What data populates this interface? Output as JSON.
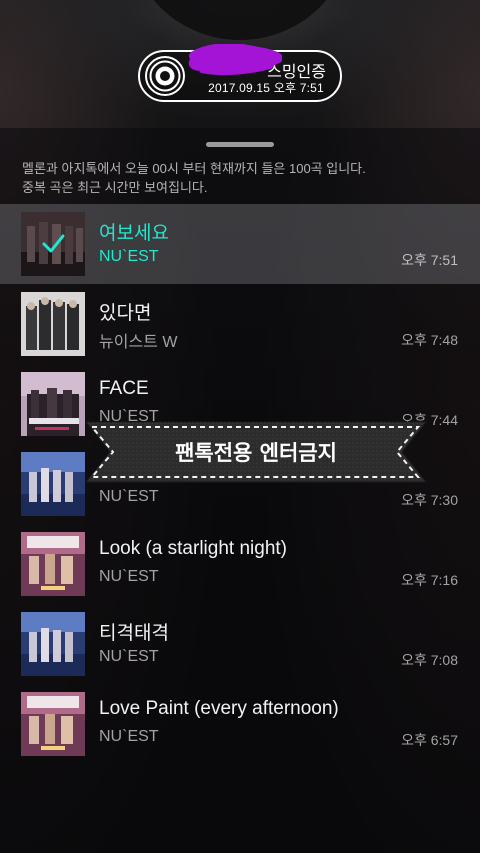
{
  "cert": {
    "title": "스밍인증",
    "date": "2017.09.15 오후 7:51"
  },
  "info": {
    "line1": "멜론과 아지톡에서 오늘 00시 부터 현재까지 들은 100곡 입니다.",
    "line2": "중복 곡은 최근 시간만 보여집니다."
  },
  "songs": [
    {
      "title": "여보세요",
      "artist": "NU`EST",
      "time": "오후 7:51",
      "selected": true
    },
    {
      "title": "있다면",
      "artist": "뉴이스트 W",
      "time": "오후 7:48"
    },
    {
      "title": "FACE",
      "artist": "NU`EST",
      "time": "오후 7:44"
    },
    {
      "title": "",
      "artist": "NU`EST",
      "time": "오후 7:30"
    },
    {
      "title": "Look (a starlight night)",
      "artist": "NU`EST",
      "time": "오후 7:16"
    },
    {
      "title": "티격태격",
      "artist": "NU`EST",
      "time": "오후 7:08"
    },
    {
      "title": "Love Paint (every afternoon)",
      "artist": "NU`EST",
      "time": "오후 6:57"
    }
  ],
  "banner": {
    "text": "팬톡전용 엔터금지"
  },
  "colors": {
    "accent": "#1ee8d2",
    "scribble": "#a314d6"
  },
  "icons": {
    "cert": "vinyl-disc-icon",
    "selected": "check-icon"
  }
}
